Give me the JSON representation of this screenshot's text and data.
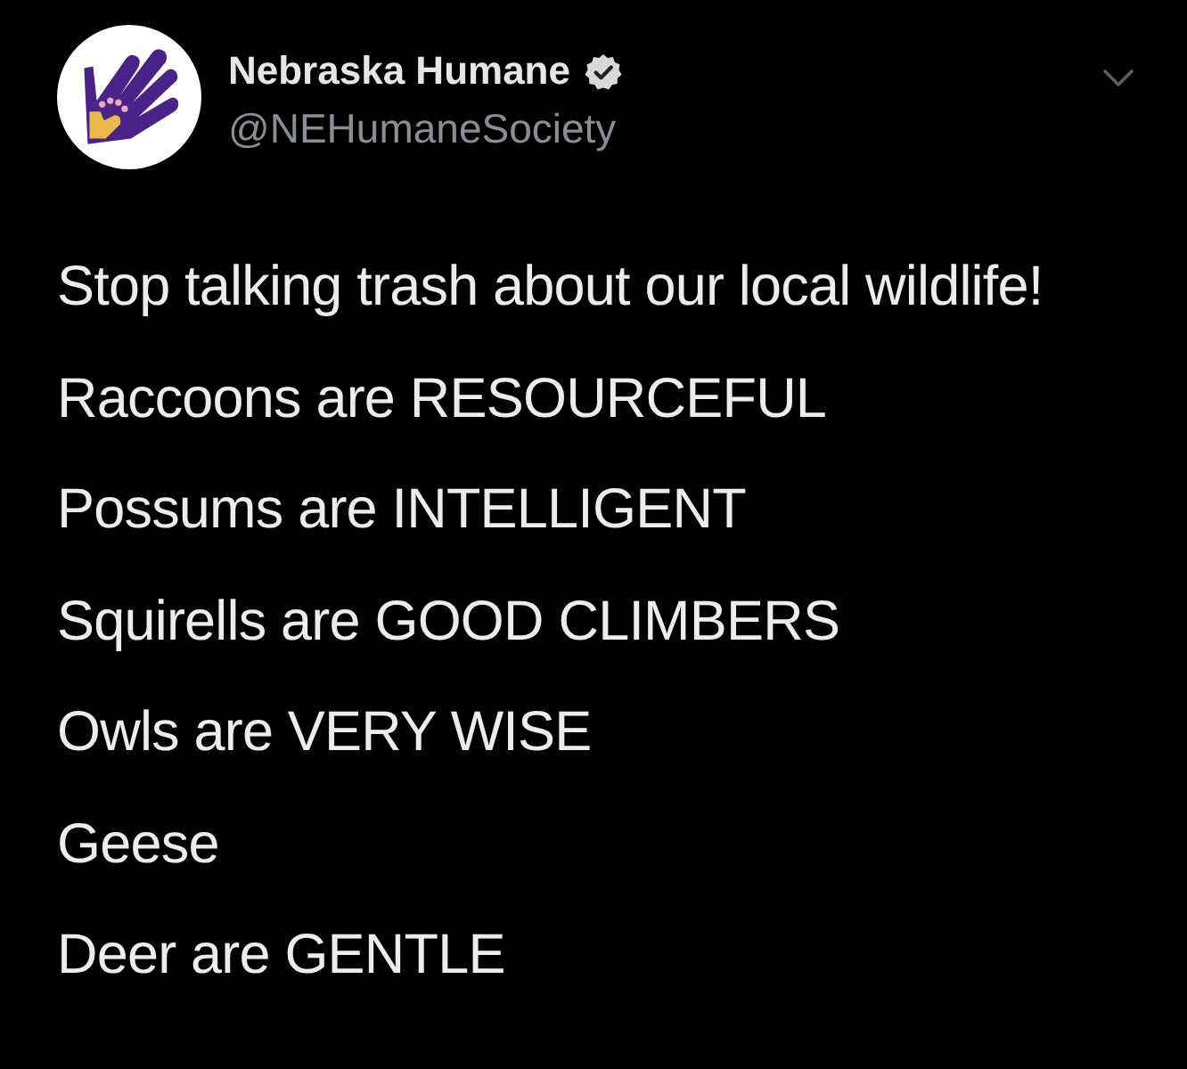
{
  "account": {
    "name": "Nebraska Humane",
    "verified": true,
    "handle": "@NEHumaneSociety"
  },
  "tweet_lines": [
    "Stop talking trash about our local wildlife!",
    "Raccoons are RESOURCEFUL",
    "Possums are INTELLIGENT",
    "Squirells are GOOD CLIMBERS",
    "Owls are VERY WISE",
    "Geese",
    "Deer are GENTLE"
  ]
}
